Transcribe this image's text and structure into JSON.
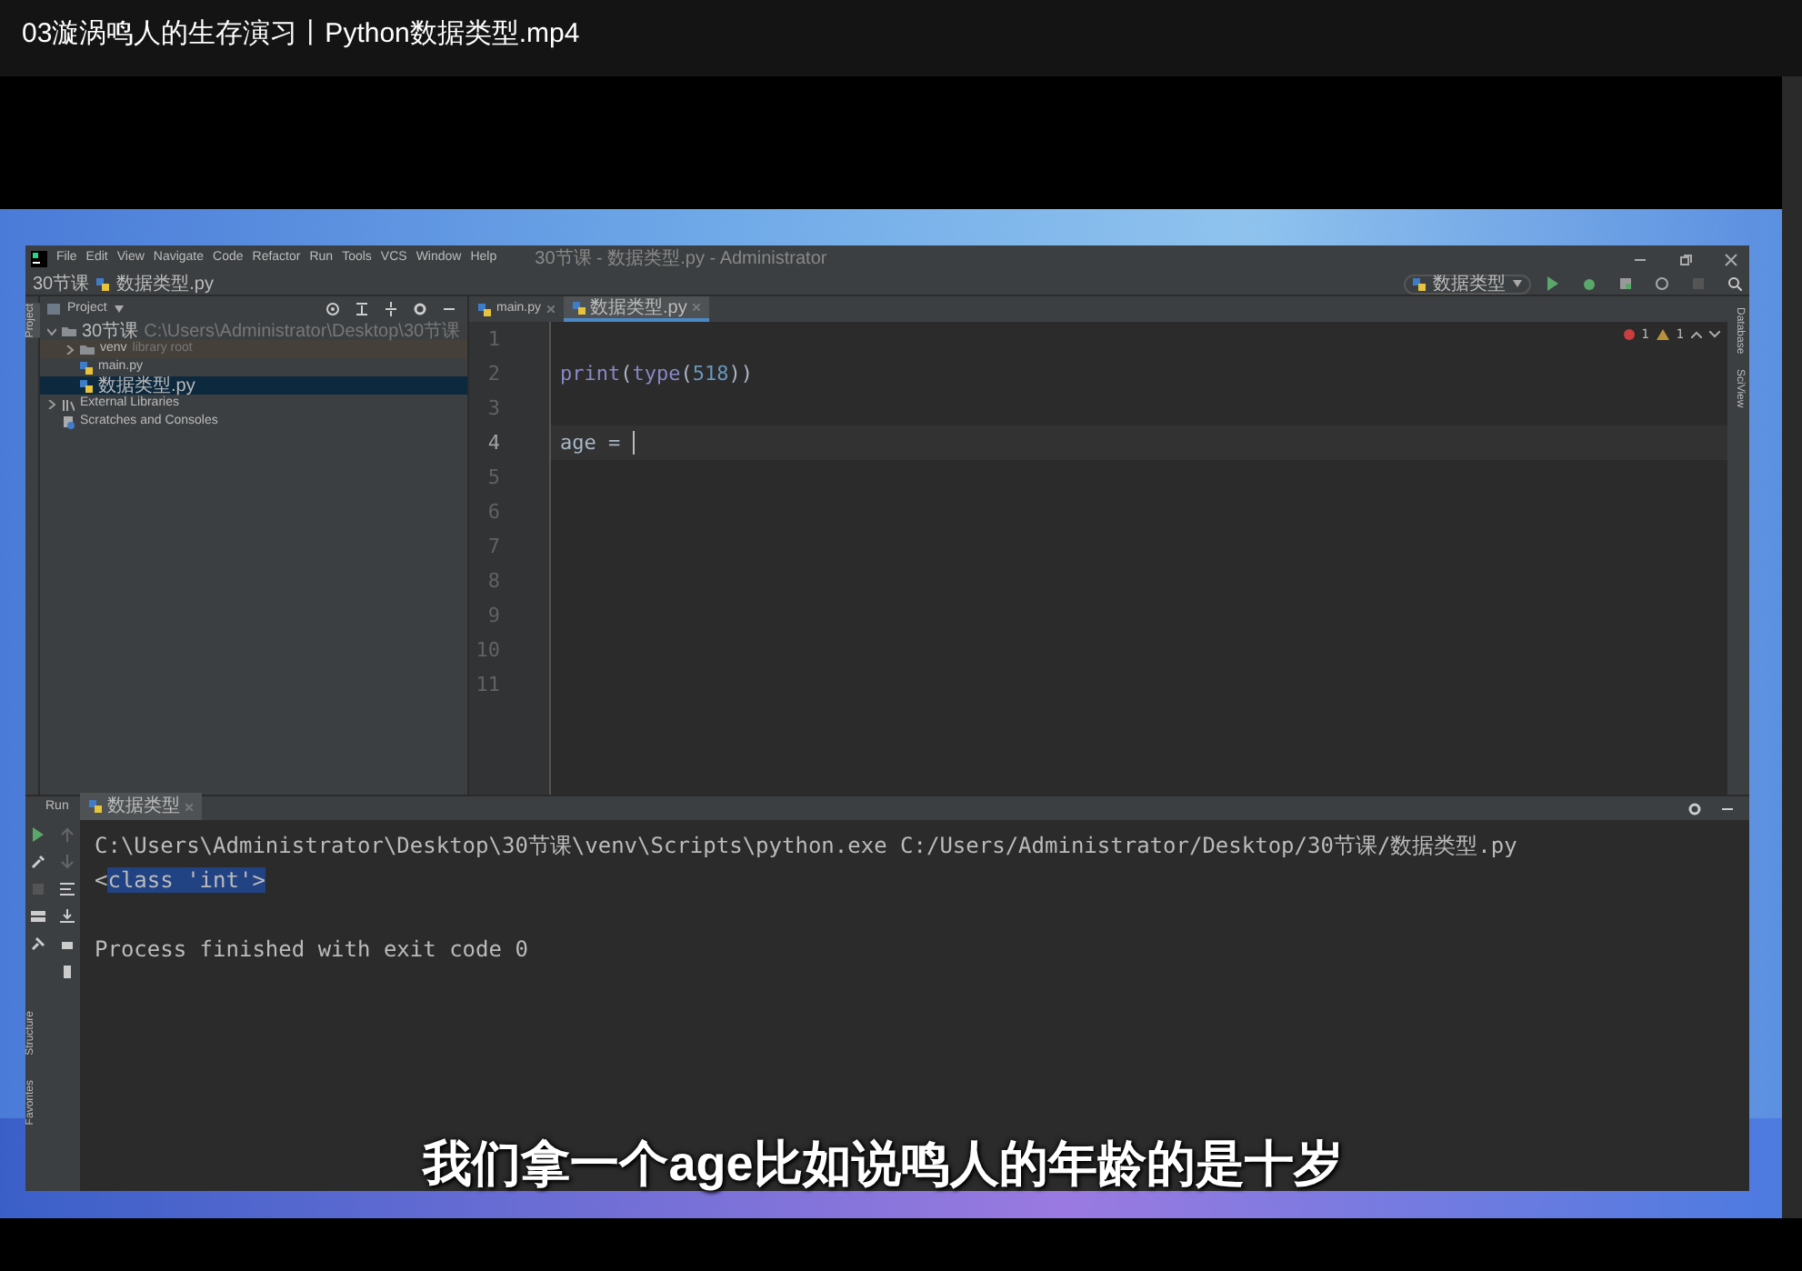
{
  "video_title": "03漩涡鸣人的生存演习丨Python数据类型.mp4",
  "ide": {
    "menu": [
      "File",
      "Edit",
      "View",
      "Navigate",
      "Code",
      "Refactor",
      "Run",
      "Tools",
      "VCS",
      "Window",
      "Help"
    ],
    "window_title": "30节课 - 数据类型.py - Administrator",
    "breadcrumb": [
      "30节课",
      "数据类型.py"
    ],
    "run_config": "数据类型",
    "project_label": "Project",
    "left_strip": [
      {
        "label": "Project",
        "selected": true
      },
      {
        "label": "Structure",
        "selected": false
      },
      {
        "label": "Favorites",
        "selected": false
      }
    ],
    "tree": [
      {
        "label": "30节课",
        "path": "C:\\Users\\Administrator\\Desktop\\30节课",
        "kind": "folder",
        "expanded": true,
        "selected": false,
        "children": [
          {
            "label": "venv",
            "note": "library root",
            "kind": "folder",
            "expanded": false,
            "selected": false
          },
          {
            "label": "main.py",
            "kind": "file",
            "selected": false
          },
          {
            "label": "数据类型.py",
            "kind": "file",
            "selected": true
          }
        ]
      },
      {
        "label": "External Libraries",
        "kind": "library",
        "expanded": false,
        "selected": false
      },
      {
        "label": "Scratches and Consoles",
        "kind": "scratch",
        "selected": false
      }
    ],
    "tabs": [
      {
        "label": "main.py",
        "selected": false
      },
      {
        "label": "数据类型.py",
        "selected": true
      }
    ],
    "inspections": {
      "errors": "1",
      "warnings": "1"
    },
    "code": [
      {
        "n": "1",
        "current": false
      },
      {
        "n": "2",
        "current": false,
        "tokens": [
          {
            "text": "print",
            "kind": "builtin"
          },
          {
            "text": "(",
            "kind": "plain"
          },
          {
            "text": "type",
            "kind": "builtin"
          },
          {
            "text": "(",
            "kind": "plain"
          },
          {
            "text": "518",
            "kind": "number"
          },
          {
            "text": "))",
            "kind": "plain"
          }
        ]
      },
      {
        "n": "3",
        "current": false
      },
      {
        "n": "4",
        "current": true,
        "tokens": [
          {
            "text": "age = ",
            "kind": "plain"
          }
        ]
      },
      {
        "n": "5",
        "current": false
      },
      {
        "n": "6",
        "current": false
      },
      {
        "n": "7",
        "current": false
      },
      {
        "n": "8",
        "current": false
      },
      {
        "n": "9",
        "current": false
      },
      {
        "n": "10",
        "current": false
      },
      {
        "n": "11",
        "current": false
      }
    ],
    "right_strip": [
      "Database",
      "SciView"
    ],
    "run": {
      "label": "Run",
      "tab": "数据类型",
      "output": [
        {
          "gap_before": false,
          "parts": [
            {
              "text": "C:\\Users\\Administrator\\Desktop\\30节课\\venv\\Scripts\\python.exe C:/Users/Administrator/Desktop/30节课/数据类型.py",
              "selected": false
            }
          ]
        },
        {
          "gap_before": false,
          "parts": [
            {
              "text": "<",
              "selected": false
            },
            {
              "text": "class 'int'>",
              "selected": true
            }
          ]
        },
        {
          "gap_before": true,
          "parts": [
            {
              "text": "Process finished with exit code 0",
              "selected": false
            }
          ]
        }
      ]
    }
  },
  "subtitle": "我们拿一个age比如说鸣人的年龄的是十岁"
}
